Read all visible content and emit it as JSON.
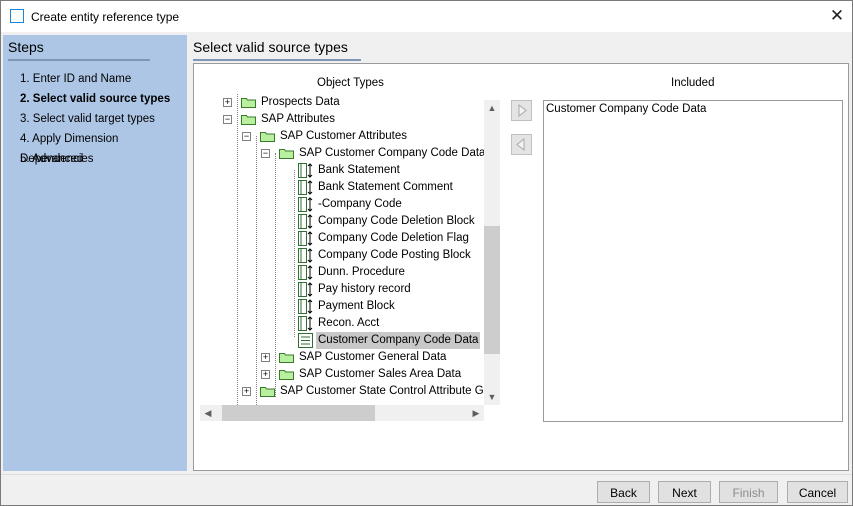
{
  "window": {
    "title": "Create entity reference type"
  },
  "sidebar": {
    "heading": "Steps",
    "steps": [
      {
        "label": "1. Enter ID and Name"
      },
      {
        "label": "2. Select valid source types"
      },
      {
        "label": "3. Select valid target types"
      },
      {
        "label": "4. Apply Dimension Dependencies"
      },
      {
        "label": "5. Advanced"
      }
    ]
  },
  "main": {
    "title": "Select valid source types",
    "object_types_header": "Object Types",
    "included_header": "Included",
    "tree": [
      {
        "label": "Prospects Data",
        "icon": "folder-icon"
      },
      {
        "label": "SAP Attributes",
        "icon": "folder-icon"
      },
      {
        "label": "SAP Customer Attributes",
        "icon": "folder-icon"
      },
      {
        "label": "SAP Customer Company Code Data",
        "icon": "folder-icon"
      },
      {
        "label": "Bank Statement",
        "icon": "attribute-icon"
      },
      {
        "label": "Bank Statement Comment",
        "icon": "attribute-icon"
      },
      {
        "label": "-Company Code",
        "icon": "attribute-icon"
      },
      {
        "label": "Company Code Deletion Block",
        "icon": "attribute-icon"
      },
      {
        "label": "Company Code Deletion Flag",
        "icon": "attribute-icon"
      },
      {
        "label": "Company Code Posting Block",
        "icon": "attribute-icon"
      },
      {
        "label": "Dunn. Procedure",
        "icon": "attribute-icon"
      },
      {
        "label": "Pay history record",
        "icon": "attribute-icon"
      },
      {
        "label": "Payment Block",
        "icon": "attribute-icon"
      },
      {
        "label": "Recon. Acct",
        "icon": "attribute-icon"
      },
      {
        "label": "Customer Company Code Data",
        "icon": "entity-type-icon",
        "selected": true
      },
      {
        "label": "SAP Customer General Data",
        "icon": "folder-icon"
      },
      {
        "label": "SAP Customer Sales Area Data",
        "icon": "folder-icon"
      },
      {
        "label": "SAP Customer State Control Attribute Gro",
        "icon": "folder-icon"
      }
    ],
    "included_items": [
      {
        "label": "Customer Company Code Data"
      }
    ]
  },
  "buttons": {
    "back": "Back",
    "next": "Next",
    "finish": "Finish",
    "cancel": "Cancel"
  },
  "colors": {
    "sidebar_bg": "#adc6e6",
    "folder_green": "#b8f0a0",
    "selection_gray": "#c8c8c8"
  }
}
